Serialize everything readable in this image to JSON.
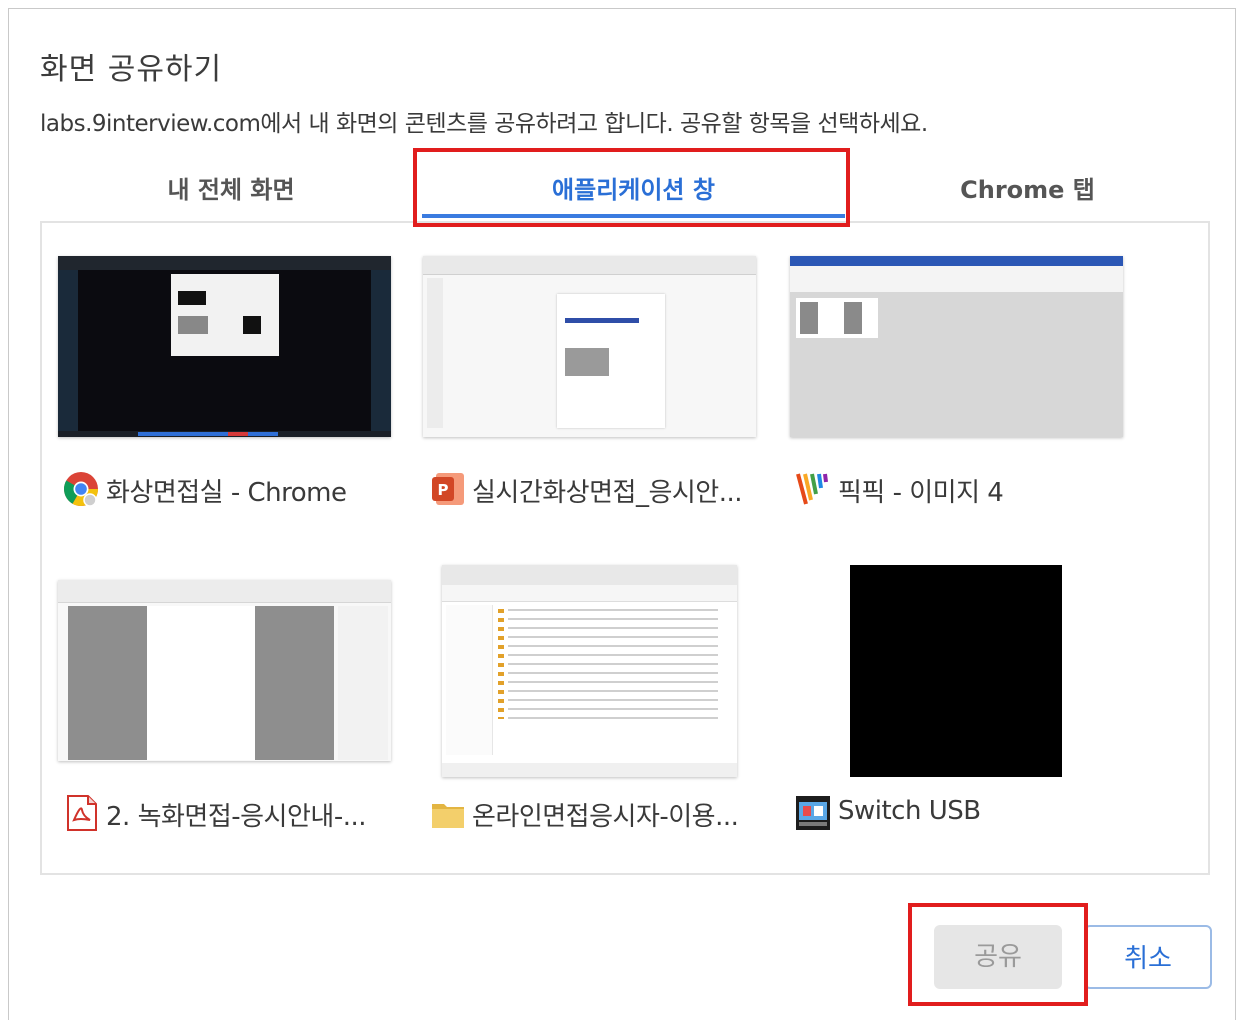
{
  "dialog": {
    "title": "화면 공유하기",
    "subtitle": "labs.9interview.com에서 내 화면의 콘텐츠를 공유하려고 합니다. 공유할 항목을 선택하세요."
  },
  "tabs": [
    {
      "label": "내 전체 화면"
    },
    {
      "label": "애플리케이션 창",
      "selected": true
    },
    {
      "label": "Chrome 탭"
    }
  ],
  "windows": [
    {
      "label": "화상면접실 - Chrome",
      "icon": "chrome-icon"
    },
    {
      "label": "실시간화상면접_응시안...",
      "icon": "powerpoint-icon"
    },
    {
      "label": "픽픽 - 이미지 4",
      "icon": "picpick-icon"
    },
    {
      "label": "2. 녹화면접-응시안내-...",
      "icon": "pdf-icon"
    },
    {
      "label": "온라인면접응시자-이용...",
      "icon": "folder-icon"
    },
    {
      "label": "Switch USB",
      "icon": "switch-usb-icon"
    }
  ],
  "buttons": {
    "share": "공유",
    "cancel": "취소"
  },
  "colors": {
    "accent": "#2a6fd6",
    "highlight": "#e11d1d"
  }
}
